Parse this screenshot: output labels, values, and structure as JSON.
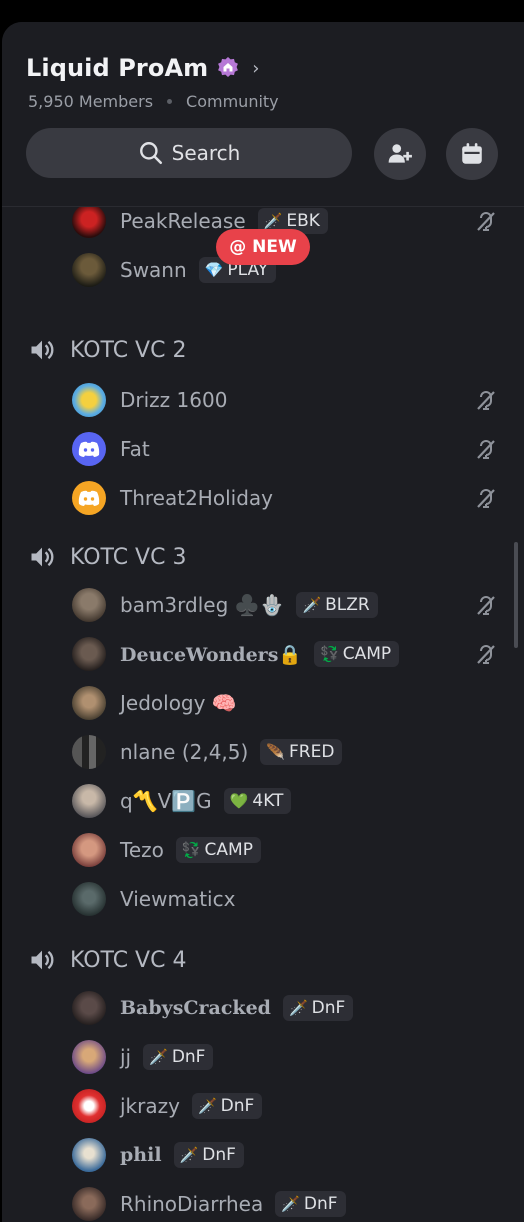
{
  "server": {
    "name": "Liquid ProAm",
    "members": "5,950 Members",
    "type": "Community",
    "search_label": "Search"
  },
  "new_pill": "@ NEW",
  "categories": [
    {
      "name": "KOTC VC 2"
    },
    {
      "name": "KOTC VC 3"
    },
    {
      "name": "KOTC VC 4"
    }
  ],
  "users": [
    {
      "name": "PeakRelease",
      "tag": "EBK",
      "tag_icon": "sword-icon",
      "muted": true
    },
    {
      "name": "Swann",
      "tag": "PLAY",
      "tag_icon": "gem-icon",
      "muted": false
    },
    {
      "name": "Drizz 1600",
      "muted": true
    },
    {
      "name": "Fat",
      "muted": true
    },
    {
      "name": "Threat2Holiday",
      "muted": true
    },
    {
      "name": "bam3rdleg ♣️🪬",
      "tag": "BLZR",
      "muted": true
    },
    {
      "name": "DeuceWonders🔒",
      "tag": "CAMP",
      "muted": true
    },
    {
      "name": "Jedology 🧠"
    },
    {
      "name": "nlane (2,4,5)",
      "tag": "FRED"
    },
    {
      "name": "q〽️V🅿️G",
      "tag": "4KT"
    },
    {
      "name": "Tezo",
      "tag": "CAMP"
    },
    {
      "name": "Viewmaticx"
    },
    {
      "name": "BabysCracked",
      "tag": "DnF"
    },
    {
      "name": "jj",
      "tag": "DnF"
    },
    {
      "name": "jkrazy",
      "tag": "DnF"
    },
    {
      "name": "phil",
      "tag": "DnF"
    },
    {
      "name": "RhinoDiarrhea",
      "tag": "DnF"
    }
  ],
  "colors": {
    "accent": "#e8424a",
    "background": "#1c1d22",
    "boost": "#b678d6",
    "discord_blue": "#5865f2",
    "discord_orange": "#f5a524"
  }
}
